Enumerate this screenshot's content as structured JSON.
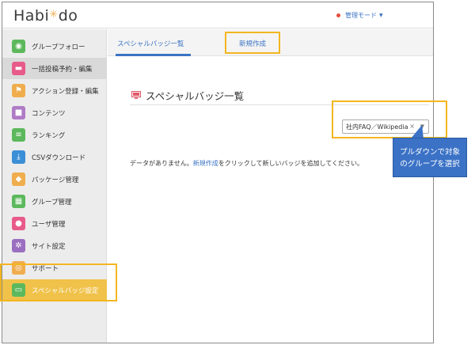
{
  "header": {
    "logo_text_a": "Habi",
    "logo_star": "✳",
    "logo_text_b": "do",
    "mode_label": "管理モード"
  },
  "sidebar": {
    "items": [
      {
        "label": "グループフォロー",
        "icon": "ear-icon",
        "color": "#5cb85c"
      },
      {
        "label": "一括投稿予約・編集",
        "icon": "chat-icon",
        "color": "#e85a8a"
      },
      {
        "label": "アクション登録・編集",
        "icon": "flag-icon",
        "color": "#f0ad4e"
      },
      {
        "label": "コンテンツ",
        "icon": "book-icon",
        "color": "#b07cc6"
      },
      {
        "label": "ランキング",
        "icon": "list-icon",
        "color": "#5cb85c"
      },
      {
        "label": "CSVダウンロード",
        "icon": "download-icon",
        "color": "#3b8fd6"
      },
      {
        "label": "パッケージ管理",
        "icon": "layers-icon",
        "color": "#f0ad4e"
      },
      {
        "label": "グループ管理",
        "icon": "grid-icon",
        "color": "#5cb85c"
      },
      {
        "label": "ユーザ管理",
        "icon": "users-icon",
        "color": "#e85a8a"
      },
      {
        "label": "サイト設定",
        "icon": "gear-icon",
        "color": "#9b6fc0"
      },
      {
        "label": "サポート",
        "icon": "help-icon",
        "color": "#f0ad4e"
      },
      {
        "label": "スペシャルバッジ設定",
        "icon": "monitor-icon",
        "color": "#5cb85c"
      }
    ]
  },
  "tabs": {
    "list": "スペシャルバッジ一覧",
    "new": "新規作成"
  },
  "section": {
    "title": "スペシャルバッジ一覧"
  },
  "group_select": {
    "value": "社内FAQ／Wikipedia"
  },
  "nodata": {
    "prefix": "データがありません。",
    "link": "新規作成",
    "suffix": "をクリックして新しいバッジを追加してください。"
  },
  "callout": {
    "line1": "プルダウンで対象",
    "line2": "のグループを選択"
  },
  "colors": {
    "accent": "#3b73c4",
    "highlight": "#f3b61f",
    "callout": "#3b72c6"
  }
}
